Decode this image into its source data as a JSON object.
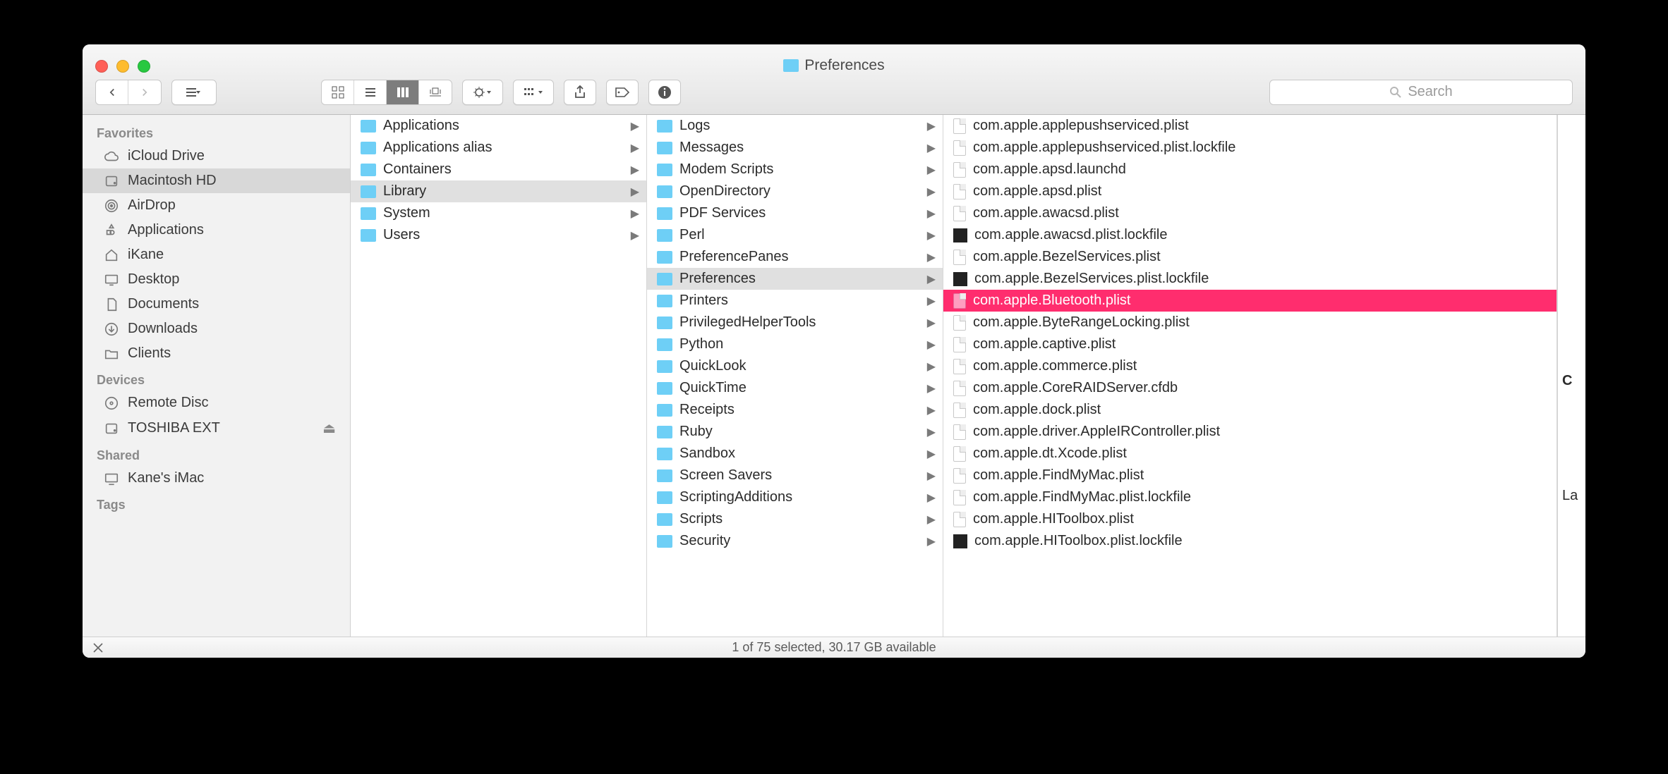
{
  "window": {
    "title": "Preferences"
  },
  "toolbar": {
    "search_placeholder": "Search"
  },
  "sidebar": {
    "sections": [
      {
        "header": "Favorites",
        "items": [
          {
            "icon": "cloud",
            "label": "iCloud Drive"
          },
          {
            "icon": "hdd",
            "label": "Macintosh HD",
            "selected": true
          },
          {
            "icon": "airdrop",
            "label": "AirDrop"
          },
          {
            "icon": "apps",
            "label": "Applications"
          },
          {
            "icon": "home",
            "label": "iKane"
          },
          {
            "icon": "desktop",
            "label": "Desktop"
          },
          {
            "icon": "doc",
            "label": "Documents"
          },
          {
            "icon": "down",
            "label": "Downloads"
          },
          {
            "icon": "folder",
            "label": "Clients"
          }
        ]
      },
      {
        "header": "Devices",
        "items": [
          {
            "icon": "disc",
            "label": "Remote Disc"
          },
          {
            "icon": "hdd",
            "label": "TOSHIBA EXT",
            "eject": true
          }
        ]
      },
      {
        "header": "Shared",
        "items": [
          {
            "icon": "monitor",
            "label": "Kane's iMac"
          }
        ]
      },
      {
        "header": "Tags",
        "items": []
      }
    ]
  },
  "columns": {
    "c1": [
      {
        "label": "Applications",
        "type": "folder",
        "arrow": true
      },
      {
        "label": "Applications alias",
        "type": "folder",
        "arrow": true
      },
      {
        "label": "Containers",
        "type": "folder",
        "arrow": true
      },
      {
        "label": "Library",
        "type": "folder",
        "arrow": true,
        "selected": true
      },
      {
        "label": "System",
        "type": "folder",
        "arrow": true
      },
      {
        "label": "Users",
        "type": "folder",
        "arrow": true
      }
    ],
    "c2": [
      {
        "label": "Logs",
        "type": "folder",
        "arrow": true
      },
      {
        "label": "Messages",
        "type": "folder",
        "arrow": true
      },
      {
        "label": "Modem Scripts",
        "type": "folder",
        "arrow": true
      },
      {
        "label": "OpenDirectory",
        "type": "folder",
        "arrow": true
      },
      {
        "label": "PDF Services",
        "type": "folder",
        "arrow": true
      },
      {
        "label": "Perl",
        "type": "folder",
        "arrow": true
      },
      {
        "label": "PreferencePanes",
        "type": "folder",
        "arrow": true
      },
      {
        "label": "Preferences",
        "type": "folder",
        "arrow": true,
        "selected": true
      },
      {
        "label": "Printers",
        "type": "folder",
        "arrow": true
      },
      {
        "label": "PrivilegedHelperTools",
        "type": "folder",
        "arrow": true
      },
      {
        "label": "Python",
        "type": "folder",
        "arrow": true
      },
      {
        "label": "QuickLook",
        "type": "folder",
        "arrow": true
      },
      {
        "label": "QuickTime",
        "type": "folder",
        "arrow": true
      },
      {
        "label": "Receipts",
        "type": "folder",
        "arrow": true
      },
      {
        "label": "Ruby",
        "type": "folder",
        "arrow": true
      },
      {
        "label": "Sandbox",
        "type": "folder",
        "arrow": true
      },
      {
        "label": "Screen Savers",
        "type": "folder",
        "arrow": true
      },
      {
        "label": "ScriptingAdditions",
        "type": "folder",
        "arrow": true
      },
      {
        "label": "Scripts",
        "type": "folder",
        "arrow": true
      },
      {
        "label": "Security",
        "type": "folder",
        "arrow": true
      }
    ],
    "c3": [
      {
        "label": "com.apple.applepushserviced.plist",
        "type": "doc"
      },
      {
        "label": "com.apple.applepushserviced.plist.lockfile",
        "type": "doc"
      },
      {
        "label": "com.apple.apsd.launchd",
        "type": "doc"
      },
      {
        "label": "com.apple.apsd.plist",
        "type": "doc"
      },
      {
        "label": "com.apple.awacsd.plist",
        "type": "doc"
      },
      {
        "label": "com.apple.awacsd.plist.lockfile",
        "type": "exec"
      },
      {
        "label": "com.apple.BezelServices.plist",
        "type": "doc"
      },
      {
        "label": "com.apple.BezelServices.plist.lockfile",
        "type": "exec"
      },
      {
        "label": "com.apple.Bluetooth.plist",
        "type": "doc-pink",
        "selected": true
      },
      {
        "label": "com.apple.ByteRangeLocking.plist",
        "type": "doc"
      },
      {
        "label": "com.apple.captive.plist",
        "type": "doc"
      },
      {
        "label": "com.apple.commerce.plist",
        "type": "doc"
      },
      {
        "label": "com.apple.CoreRAIDServer.cfdb",
        "type": "doc"
      },
      {
        "label": "com.apple.dock.plist",
        "type": "doc"
      },
      {
        "label": "com.apple.driver.AppleIRController.plist",
        "type": "doc"
      },
      {
        "label": "com.apple.dt.Xcode.plist",
        "type": "doc"
      },
      {
        "label": "com.apple.FindMyMac.plist",
        "type": "doc"
      },
      {
        "label": "com.apple.FindMyMac.plist.lockfile",
        "type": "doc"
      },
      {
        "label": "com.apple.HIToolbox.plist",
        "type": "doc"
      },
      {
        "label": "com.apple.HIToolbox.plist.lockfile",
        "type": "exec"
      }
    ]
  },
  "preview": {
    "line1": "C",
    "line2": "La"
  },
  "status": {
    "text": "1 of 75 selected, 30.17 GB available"
  }
}
